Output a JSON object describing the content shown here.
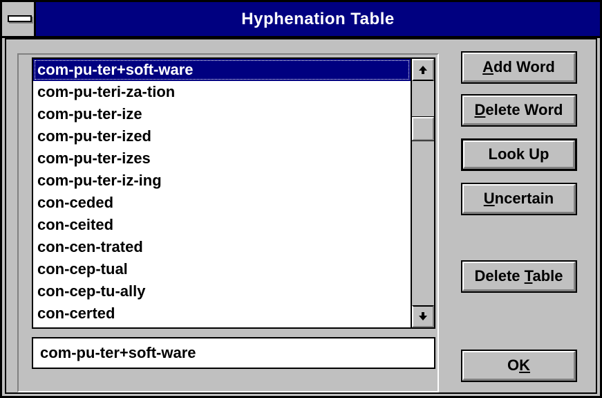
{
  "window": {
    "title": "Hyphenation Table"
  },
  "list": {
    "items": [
      "com-pu-ter+soft-ware",
      "com-pu-teri-za-tion",
      "com-pu-ter-ize",
      "com-pu-ter-ized",
      "com-pu-ter-izes",
      "com-pu-ter-iz-ing",
      "con-ceded",
      "con-ceited",
      "con-cen-trated",
      "con-cep-tual",
      "con-cep-tu-ally",
      "con-certed"
    ],
    "selected_index": 0,
    "scroll_up_icon": "up-arrow-icon",
    "scroll_down_icon": "down-arrow-icon"
  },
  "edit": {
    "value": "com-pu-ter+soft-ware"
  },
  "buttons": {
    "add_word": "Add Word",
    "add_word_mnemonic": "A",
    "delete_word": "Delete Word",
    "delete_word_mnemonic": "D",
    "look_up": "Look Up",
    "uncertain": "Uncertain",
    "uncertain_mnemonic": "U",
    "delete_table": "Delete Table",
    "delete_table_mnemonic": "T",
    "ok": "OK",
    "ok_mnemonic": "K"
  },
  "colors": {
    "titlebar": "#000080",
    "face": "#c0c0c0",
    "selection": "#000080"
  }
}
